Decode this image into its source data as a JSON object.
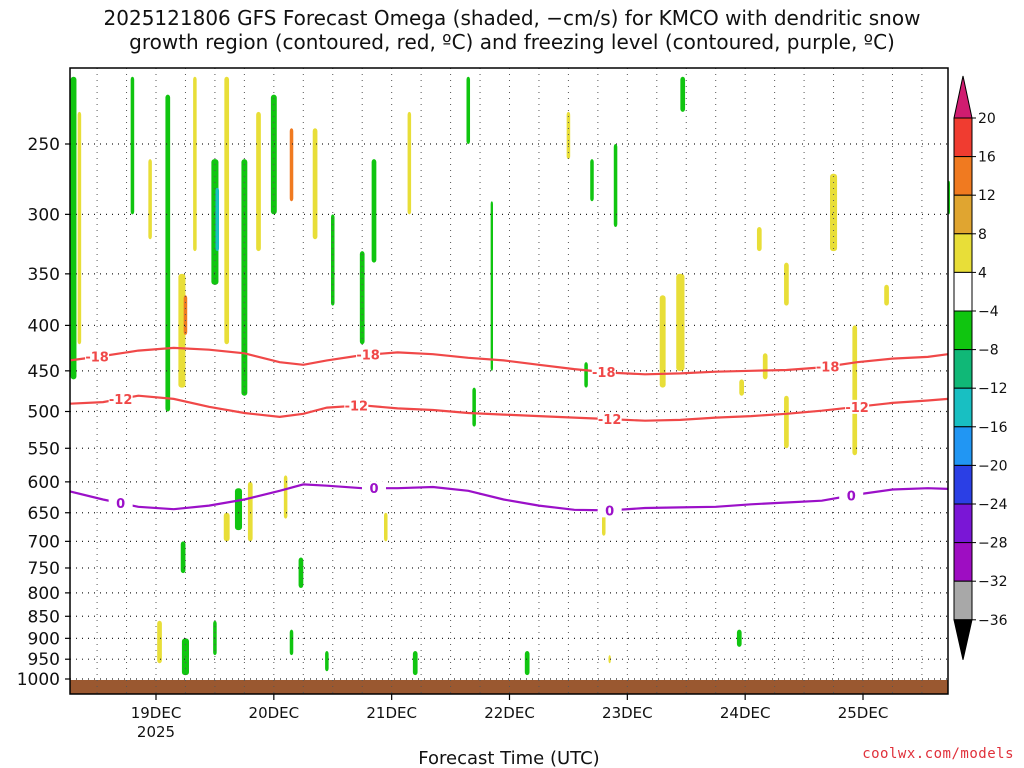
{
  "chart_data": {
    "type": "heatmap",
    "title_line1": "2025121806 GFS Forecast Omega (shaded, −cm/s) for KMCO with dendritic snow",
    "title_line2": "growth region (contoured, red, ºC) and freezing level (contoured, purple, ºC)",
    "xlabel": "Forecast Time (UTC)",
    "x_ticks": [
      {
        "label": "19DEC",
        "sub": "2025",
        "time": 18.75
      },
      {
        "label": "20DEC",
        "sub": "",
        "time": 19.75
      },
      {
        "label": "21DEC",
        "sub": "",
        "time": 20.75
      },
      {
        "label": "22DEC",
        "sub": "",
        "time": 21.75
      },
      {
        "label": "23DEC",
        "sub": "",
        "time": 22.75
      },
      {
        "label": "24DEC",
        "sub": "",
        "time": 23.75
      },
      {
        "label": "25DEC",
        "sub": "",
        "time": 24.75
      }
    ],
    "xlim": [
      18,
      25.7
    ],
    "y_ticks": [
      "250",
      "300",
      "350",
      "400",
      "450",
      "500",
      "550",
      "600",
      "650",
      "700",
      "750",
      "800",
      "850",
      "900",
      "950",
      "1000"
    ],
    "y_values": [
      250,
      300,
      350,
      400,
      450,
      500,
      550,
      600,
      650,
      700,
      750,
      800,
      850,
      900,
      950,
      1000
    ],
    "ylim": [
      200,
      1020
    ],
    "y_scale": "log",
    "grid": true,
    "colorbar_labels": [
      "20",
      "16",
      "12",
      "8",
      "4",
      "−4",
      "−8",
      "−12",
      "−16",
      "−20",
      "−24",
      "−28",
      "−32",
      "−36"
    ],
    "colorbar_colors": [
      "#d01c70",
      "#f03c30",
      "#f07a20",
      "#e0a530",
      "#e8de38",
      "#ffffff",
      "#10c510",
      "#10b877",
      "#18bfc2",
      "#2196f3",
      "#2b3fe5",
      "#7a16d6",
      "#9e0dc2",
      "#a8a8a8",
      "#000000"
    ],
    "contours": [
      {
        "label": "-18",
        "color": "#f04848",
        "x": [
          18.0,
          18.3,
          18.6,
          18.9,
          19.2,
          19.5,
          19.8,
          20.0,
          20.2,
          20.5,
          20.8,
          21.1,
          21.4,
          21.7,
          22.0,
          22.3,
          22.6,
          22.9,
          23.2,
          23.5,
          23.8,
          24.1,
          24.4,
          24.7,
          25.0,
          25.3,
          25.7
        ],
        "y": [
          438,
          433,
          427,
          424,
          426,
          430,
          440,
          443,
          438,
          432,
          429,
          431,
          435,
          438,
          443,
          448,
          452,
          454,
          453,
          451,
          450,
          449,
          446,
          440,
          436,
          434,
          431
        ],
        "label_x": [
          18.25,
          20.55,
          22.55,
          24.45
        ]
      },
      {
        "label": "-12",
        "color": "#f04848",
        "x": [
          18.0,
          18.3,
          18.6,
          18.9,
          19.2,
          19.5,
          19.8,
          20.0,
          20.2,
          20.5,
          20.8,
          21.1,
          21.4,
          21.7,
          22.0,
          22.3,
          22.6,
          22.9,
          23.2,
          23.5,
          23.8,
          24.1,
          24.4,
          24.7,
          25.0,
          25.3,
          25.7
        ],
        "y": [
          490,
          488,
          480,
          484,
          494,
          502,
          507,
          503,
          495,
          492,
          496,
          498,
          502,
          504,
          506,
          508,
          510,
          512,
          511,
          508,
          506,
          503,
          499,
          494,
          489,
          486,
          484
        ],
        "label_x": [
          18.45,
          20.45,
          22.6,
          24.7
        ]
      },
      {
        "label": "0",
        "color": "#9b10c8",
        "x": [
          18.0,
          18.3,
          18.6,
          18.9,
          19.2,
          19.5,
          19.8,
          20.0,
          20.2,
          20.5,
          20.8,
          21.1,
          21.4,
          21.7,
          22.0,
          22.3,
          22.6,
          22.9,
          23.2,
          23.5,
          23.8,
          24.1,
          24.4,
          24.7,
          25.0,
          25.3,
          25.7
        ],
        "y": [
          615,
          628,
          640,
          644,
          638,
          628,
          614,
          604,
          606,
          610,
          610,
          608,
          614,
          628,
          638,
          645,
          646,
          642,
          641,
          640,
          636,
          633,
          630,
          620,
          612,
          610,
          611
        ],
        "label_x": [
          18.45,
          20.6,
          22.6,
          24.65
        ]
      }
    ],
    "shading": [
      {
        "x": 18.05,
        "p1": 210,
        "p2": 460,
        "w": 0.05,
        "c": "#10c510"
      },
      {
        "x": 18.1,
        "p1": 230,
        "p2": 420,
        "w": 0.03,
        "c": "#e8de38"
      },
      {
        "x": 18.55,
        "p1": 210,
        "p2": 300,
        "w": 0.03,
        "c": "#10c510"
      },
      {
        "x": 18.7,
        "p1": 260,
        "p2": 320,
        "w": 0.03,
        "c": "#e8de38"
      },
      {
        "x": 18.85,
        "p1": 220,
        "p2": 500,
        "w": 0.04,
        "c": "#10c510"
      },
      {
        "x": 18.97,
        "p1": 350,
        "p2": 470,
        "w": 0.06,
        "c": "#e8de38"
      },
      {
        "x": 19.0,
        "p1": 370,
        "p2": 410,
        "w": 0.03,
        "c": "#f07a20"
      },
      {
        "x": 19.08,
        "p1": 210,
        "p2": 330,
        "w": 0.03,
        "c": "#e8de38"
      },
      {
        "x": 19.25,
        "p1": 260,
        "p2": 360,
        "w": 0.06,
        "c": "#10c510"
      },
      {
        "x": 19.27,
        "p1": 280,
        "p2": 330,
        "w": 0.03,
        "c": "#18bfc2"
      },
      {
        "x": 19.35,
        "p1": 210,
        "p2": 420,
        "w": 0.04,
        "c": "#e8de38"
      },
      {
        "x": 19.5,
        "p1": 260,
        "p2": 480,
        "w": 0.05,
        "c": "#10c510"
      },
      {
        "x": 19.62,
        "p1": 230,
        "p2": 330,
        "w": 0.04,
        "c": "#e8de38"
      },
      {
        "x": 19.75,
        "p1": 220,
        "p2": 300,
        "w": 0.05,
        "c": "#10c510"
      },
      {
        "x": 19.9,
        "p1": 240,
        "p2": 290,
        "w": 0.03,
        "c": "#f07a20"
      },
      {
        "x": 20.1,
        "p1": 240,
        "p2": 320,
        "w": 0.04,
        "c": "#e8de38"
      },
      {
        "x": 20.25,
        "p1": 300,
        "p2": 380,
        "w": 0.03,
        "c": "#10c510"
      },
      {
        "x": 20.5,
        "p1": 330,
        "p2": 420,
        "w": 0.04,
        "c": "#10c510"
      },
      {
        "x": 20.6,
        "p1": 260,
        "p2": 340,
        "w": 0.04,
        "c": "#10c510"
      },
      {
        "x": 20.9,
        "p1": 230,
        "p2": 300,
        "w": 0.03,
        "c": "#e8de38"
      },
      {
        "x": 21.6,
        "p1": 290,
        "p2": 450,
        "w": 0.02,
        "c": "#10c510"
      },
      {
        "x": 21.4,
        "p1": 210,
        "p2": 250,
        "w": 0.03,
        "c": "#10c510"
      },
      {
        "x": 22.25,
        "p1": 230,
        "p2": 260,
        "w": 0.03,
        "c": "#e8de38"
      },
      {
        "x": 22.45,
        "p1": 260,
        "p2": 290,
        "w": 0.03,
        "c": "#10c510"
      },
      {
        "x": 22.65,
        "p1": 250,
        "p2": 310,
        "w": 0.03,
        "c": "#10c510"
      },
      {
        "x": 23.05,
        "p1": 370,
        "p2": 470,
        "w": 0.05,
        "c": "#e8de38"
      },
      {
        "x": 23.2,
        "p1": 350,
        "p2": 450,
        "w": 0.07,
        "c": "#e8de38"
      },
      {
        "x": 23.22,
        "p1": 210,
        "p2": 230,
        "w": 0.04,
        "c": "#10c510"
      },
      {
        "x": 23.72,
        "p1": 460,
        "p2": 480,
        "w": 0.04,
        "c": "#e8de38"
      },
      {
        "x": 23.87,
        "p1": 310,
        "p2": 330,
        "w": 0.04,
        "c": "#e8de38"
      },
      {
        "x": 23.92,
        "p1": 430,
        "p2": 460,
        "w": 0.04,
        "c": "#e8de38"
      },
      {
        "x": 24.1,
        "p1": 340,
        "p2": 380,
        "w": 0.04,
        "c": "#e8de38"
      },
      {
        "x": 24.1,
        "p1": 480,
        "p2": 550,
        "w": 0.04,
        "c": "#e8de38"
      },
      {
        "x": 24.5,
        "p1": 270,
        "p2": 330,
        "w": 0.06,
        "c": "#e8de38"
      },
      {
        "x": 24.68,
        "p1": 400,
        "p2": 560,
        "w": 0.04,
        "c": "#e8de38"
      },
      {
        "x": 24.95,
        "p1": 360,
        "p2": 380,
        "w": 0.04,
        "c": "#e8de38"
      },
      {
        "x": 25.58,
        "p1": 275,
        "p2": 300,
        "w": 0.04,
        "c": "#10c510"
      },
      {
        "x": 19.35,
        "p1": 650,
        "p2": 700,
        "w": 0.05,
        "c": "#e8de38"
      },
      {
        "x": 19.45,
        "p1": 610,
        "p2": 680,
        "w": 0.06,
        "c": "#10c510"
      },
      {
        "x": 19.55,
        "p1": 600,
        "p2": 700,
        "w": 0.04,
        "c": "#e8de38"
      },
      {
        "x": 19.85,
        "p1": 590,
        "p2": 660,
        "w": 0.03,
        "c": "#e8de38"
      },
      {
        "x": 19.98,
        "p1": 730,
        "p2": 790,
        "w": 0.04,
        "c": "#10c510"
      },
      {
        "x": 18.98,
        "p1": 700,
        "p2": 760,
        "w": 0.04,
        "c": "#10c510"
      },
      {
        "x": 18.78,
        "p1": 860,
        "p2": 960,
        "w": 0.04,
        "c": "#e8de38"
      },
      {
        "x": 19.0,
        "p1": 900,
        "p2": 990,
        "w": 0.06,
        "c": "#10c510"
      },
      {
        "x": 19.25,
        "p1": 860,
        "p2": 940,
        "w": 0.03,
        "c": "#10c510"
      },
      {
        "x": 19.9,
        "p1": 880,
        "p2": 940,
        "w": 0.03,
        "c": "#10c510"
      },
      {
        "x": 20.2,
        "p1": 930,
        "p2": 980,
        "w": 0.03,
        "c": "#10c510"
      },
      {
        "x": 20.95,
        "p1": 930,
        "p2": 990,
        "w": 0.04,
        "c": "#10c510"
      },
      {
        "x": 21.9,
        "p1": 930,
        "p2": 990,
        "w": 0.04,
        "c": "#10c510"
      },
      {
        "x": 21.45,
        "p1": 470,
        "p2": 520,
        "w": 0.03,
        "c": "#10c510"
      },
      {
        "x": 22.4,
        "p1": 440,
        "p2": 470,
        "w": 0.03,
        "c": "#10c510"
      },
      {
        "x": 20.7,
        "p1": 650,
        "p2": 700,
        "w": 0.03,
        "c": "#e8de38"
      },
      {
        "x": 22.55,
        "p1": 640,
        "p2": 690,
        "w": 0.03,
        "c": "#e8de38"
      },
      {
        "x": 23.7,
        "p1": 880,
        "p2": 920,
        "w": 0.04,
        "c": "#10c510"
      },
      {
        "x": 22.6,
        "p1": 940,
        "p2": 960,
        "w": 0.02,
        "c": "#e8de38"
      }
    ]
  },
  "credit": "coolwx.com/models"
}
